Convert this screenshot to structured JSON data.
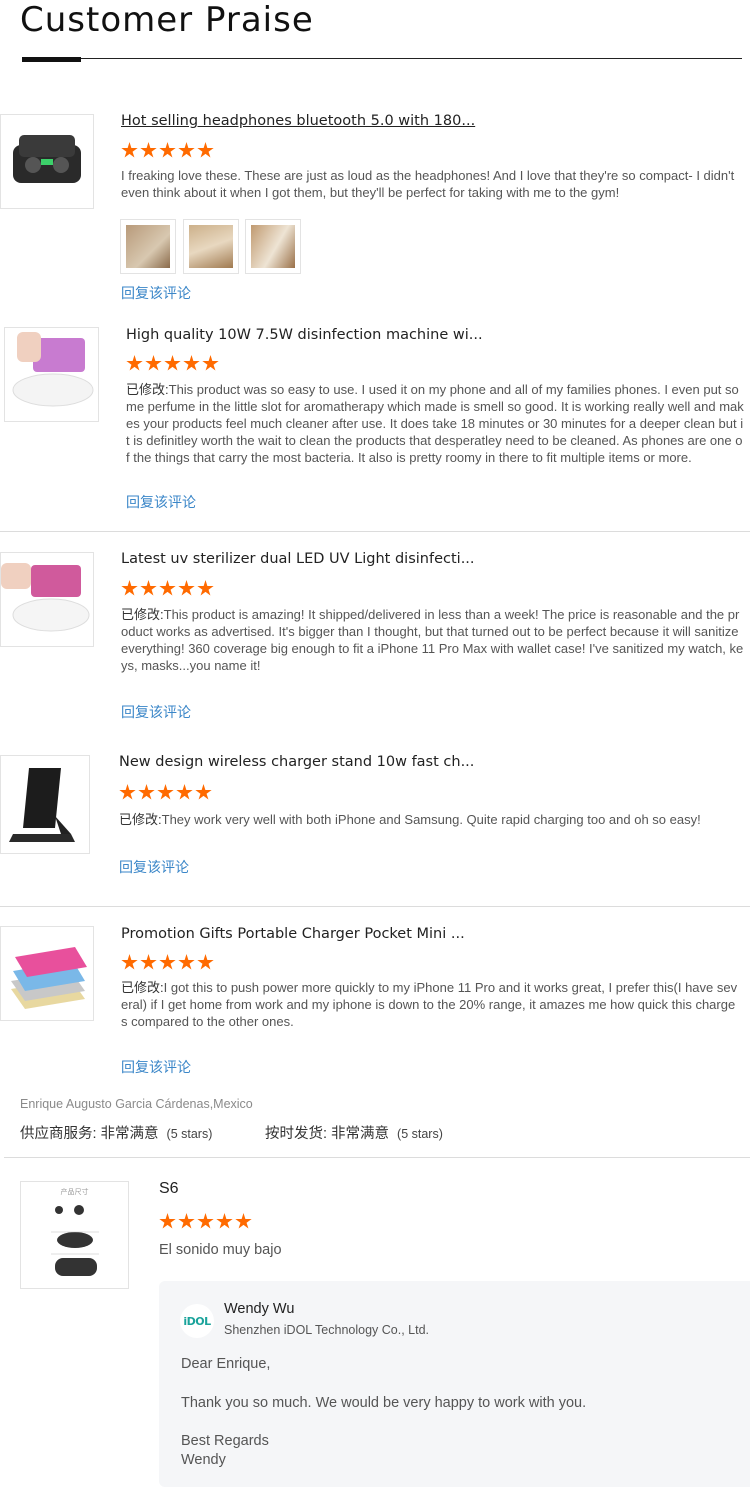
{
  "header": {
    "title": "Customer Praise"
  },
  "reviews": [
    {
      "title": "Hot selling headphones bluetooth 5.0 with 180...",
      "stars": 5,
      "prefix": "",
      "text": "I freaking love these. These are just as loud as the headphones! And I love that they're so compact- I didn't even think about it when I got them, but they'll be perfect for taking with me to the gym!",
      "reply_label": "回复该评论"
    },
    {
      "title": "High quality 10W 7.5W disinfection machine wi...",
      "stars": 5,
      "prefix": "已修改:",
      "text": "This product was so easy to use. I used it on my phone and all of my families phones. I even put some perfume in the little slot for aromatherapy which made is smell so good. It is working really well and makes your products feel much cleaner after use. It does take 18 minutes or 30 minutes for a deeper clean but it is definitley worth the wait to clean the products that desperatley need to be cleaned. As phones are one of the things that carry the most bacteria. It also is pretty roomy in there to fit multiple items or more.",
      "reply_label": "回复该评论"
    },
    {
      "title": "Latest uv sterilizer dual LED UV Light disinfecti...",
      "stars": 5,
      "prefix": "已修改:",
      "text": "This product is amazing! It shipped/delivered in less than a week! The price is reasonable and the product works as advertised. It's bigger than I thought, but that turned out to be perfect because it will sanitize everything! 360 coverage big enough to fit a iPhone 11 Pro Max with wallet case! I've sanitized my watch, keys, masks...you name it!",
      "reply_label": "回复该评论"
    },
    {
      "title": "New design wireless charger stand 10w fast ch...",
      "stars": 5,
      "prefix": "已修改:",
      "text": "They work very well with both iPhone and Samsung. Quite rapid charging too and oh so easy!",
      "reply_label": "回复该评论"
    },
    {
      "title": "Promotion Gifts Portable Charger Pocket Mini ...",
      "stars": 5,
      "prefix": "已修改:",
      "text": "I got this to push power more quickly to my iPhone 11 Pro and it works great, I prefer this(I have several) if I get home from work and my iphone is down to the 20% range, it amazes me how quick this charges compared to the other ones.",
      "reply_label": "回复该评论"
    }
  ],
  "reviewer": {
    "name_line": "Enrique Augusto Garcia Cárdenas,Mexico",
    "supplier_service_label": "供应商服务:",
    "supplier_service_value": "非常满意",
    "supplier_service_stars": "(5 stars)",
    "on_time_label": "按时发货:",
    "on_time_value": "非常满意",
    "on_time_stars": "(5 stars)"
  },
  "s6": {
    "title": "S6",
    "stars": 5,
    "text": "El sonido muy bajo",
    "thumb_caption": "产品尺寸"
  },
  "reply": {
    "logo_text": "iDOL",
    "name": "Wendy Wu",
    "company": "Shenzhen iDOL Technology Co., Ltd.",
    "greeting": "Dear Enrique,",
    "body": "Thank you so much. We would be very happy to work with you.",
    "closing": "Best Regards",
    "signature": "Wendy"
  },
  "colors": {
    "star": "#ff6a00",
    "link": "#3a86c8",
    "brand_logo": "#1aa39b"
  }
}
